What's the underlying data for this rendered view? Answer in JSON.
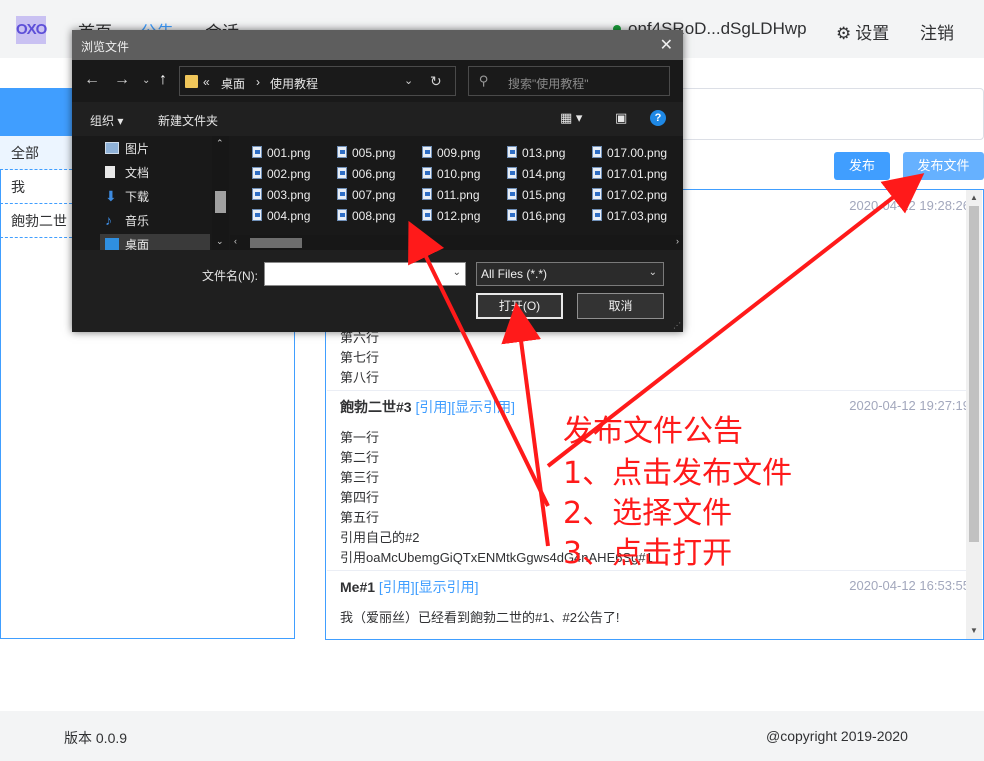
{
  "app": {
    "logo": "OXO",
    "nav": [
      "首页",
      "公告",
      "会话"
    ],
    "user_id": "onf4SRoD...dSgLDHwp",
    "settings_label": "设置",
    "logout_label": "注销"
  },
  "sidebar": {
    "items": [
      {
        "label": "全部"
      },
      {
        "label": "我"
      },
      {
        "label": "飽勃二世"
      }
    ]
  },
  "actions": {
    "publish_label": "发布",
    "publish_file_label": "发布文件"
  },
  "feed": {
    "top_time": "2020-04-12 19:28:26",
    "post1_tail_lines": [
      "第六行",
      "第七行",
      "第八行"
    ],
    "post2": {
      "author": "飽勃二世#3",
      "quote_link": "[引用]",
      "show_quote_link": "[显示引用]",
      "time": "2020-04-12 19:27:19",
      "lines": [
        "第一行",
        "第二行",
        "第三行",
        "第四行",
        "第五行",
        "引用自己的#2",
        "引用oaMcUbemgGiQTxENMtkGgws4dG4nAHE6Sg#1"
      ]
    },
    "post3": {
      "author": "Me#1",
      "quote_link": "[引用]",
      "show_quote_link": "[显示引用]",
      "time": "2020-04-12 16:53:55",
      "lines": [
        "我（爱丽丝）已经看到飽勃二世的#1、#2公告了!"
      ]
    }
  },
  "footer": {
    "version": "版本 0.0.9",
    "copyright": "@copyright 2019-2020"
  },
  "dialog": {
    "title": "浏览文件",
    "path": [
      "«",
      "桌面",
      "›",
      "使用教程"
    ],
    "search_placeholder": "搜索\"使用教程\"",
    "organize_label": "组织 ▾",
    "new_folder_label": "新建文件夹",
    "tree": [
      {
        "label": "图片",
        "icon": "pictures-icon"
      },
      {
        "label": "文档",
        "icon": "documents-icon"
      },
      {
        "label": "下载",
        "icon": "download-icon"
      },
      {
        "label": "音乐",
        "icon": "music-icon"
      },
      {
        "label": "桌面",
        "icon": "desktop-icon"
      }
    ],
    "files": [
      "001.png",
      "005.png",
      "009.png",
      "013.png",
      "017.00.png",
      "002.png",
      "006.png",
      "010.png",
      "014.png",
      "017.01.png",
      "003.png",
      "007.png",
      "011.png",
      "015.png",
      "017.02.png",
      "004.png",
      "008.png",
      "012.png",
      "016.png",
      "017.03.png"
    ],
    "filename_label": "文件名(N):",
    "filename_value": "",
    "filetype": "All Files (*.*)",
    "open_label": "打开(O)",
    "cancel_label": "取消"
  },
  "annotation": {
    "title": "发布文件公告",
    "steps": [
      "1、点击发布文件",
      "2、选择文件",
      "3、点击打开"
    ],
    "color": "#ff1a1a"
  },
  "colors": {
    "accent": "#409eff",
    "dialog_bg": "#202020",
    "dialog_title_bg": "#5e5e5e"
  }
}
